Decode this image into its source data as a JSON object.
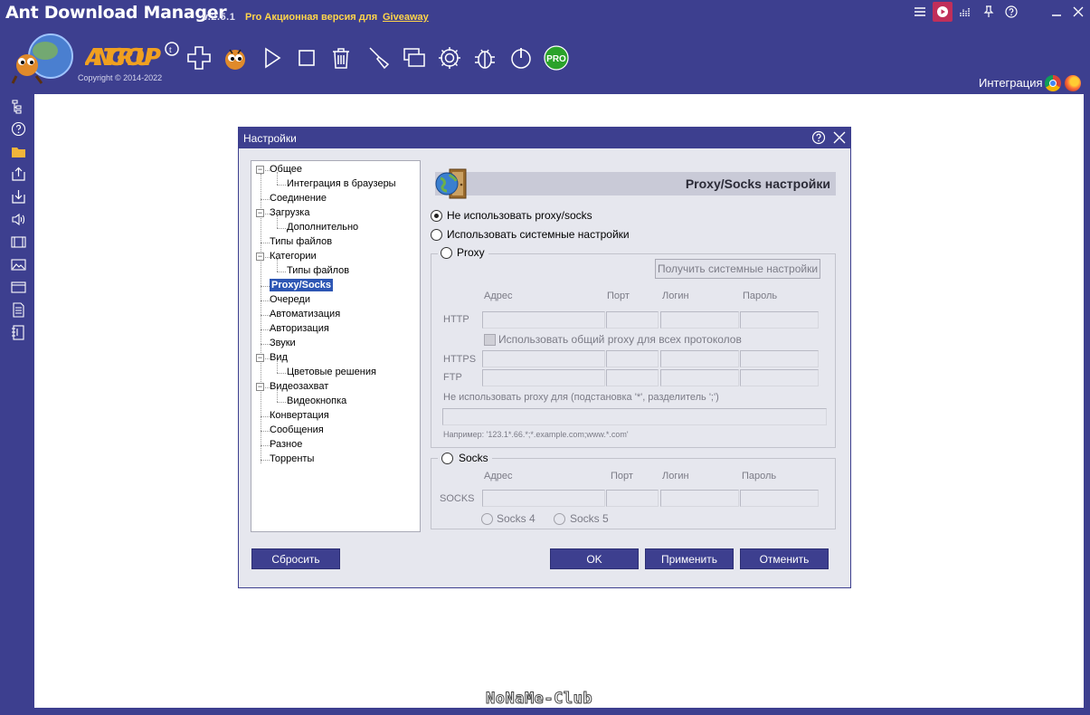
{
  "window": {
    "title": "Ant Download Manager",
    "version": "v.2.5.1",
    "promo": "Pro Акционная версия для",
    "promo_link": "Giveaway"
  },
  "toolbar": {
    "brand_text": "ANT GROUP",
    "copyright": "Copyright © 2014-2022",
    "buttons": [
      "add-icon",
      "ant-icon",
      "play-icon",
      "stop-icon",
      "trash-icon",
      "sweep-icon",
      "windows-icon",
      "gear-icon",
      "bug-icon",
      "power-icon",
      "pro-icon"
    ],
    "pro_label": "PRO",
    "integration_label": "Интеграция"
  },
  "sidebar": {
    "icons": [
      "tree-icon",
      "help-icon",
      "folder-icon",
      "upload-icon",
      "download-icon",
      "audio-icon",
      "video-icon",
      "image-icon",
      "window-icon",
      "document-icon",
      "archive-icon"
    ]
  },
  "dialog": {
    "title": "Настройки",
    "tree": [
      {
        "label": "Общее",
        "level": 0,
        "expandable": true
      },
      {
        "label": "Интеграция в браузеры",
        "level": 1
      },
      {
        "label": "Соединение",
        "level": 0
      },
      {
        "label": "Загрузка",
        "level": 0,
        "expandable": true
      },
      {
        "label": "Дополнительно",
        "level": 1
      },
      {
        "label": "Типы файлов",
        "level": 0
      },
      {
        "label": "Категории",
        "level": 0,
        "expandable": true
      },
      {
        "label": "Типы файлов",
        "level": 1
      },
      {
        "label": "Proxy/Socks",
        "level": 0,
        "selected": true
      },
      {
        "label": "Очереди",
        "level": 0
      },
      {
        "label": "Автоматизация",
        "level": 0
      },
      {
        "label": "Авторизация",
        "level": 0
      },
      {
        "label": "Звуки",
        "level": 0
      },
      {
        "label": "Вид",
        "level": 0,
        "expandable": true
      },
      {
        "label": "Цветовые решения",
        "level": 1
      },
      {
        "label": "Видеозахват",
        "level": 0,
        "expandable": true
      },
      {
        "label": "Видеокнопка",
        "level": 1
      },
      {
        "label": "Конвертация",
        "level": 0
      },
      {
        "label": "Сообщения",
        "level": 0
      },
      {
        "label": "Разное",
        "level": 0
      },
      {
        "label": "Торренты",
        "level": 0
      }
    ],
    "panel_title": "Proxy/Socks настройки",
    "opt_no_proxy": "Не использовать proxy/socks",
    "opt_system": "Использовать системные настройки",
    "opt_proxy": "Proxy",
    "get_system_btn": "Получить системные настройки",
    "col_address": "Адрес",
    "col_port": "Порт",
    "col_login": "Логин",
    "col_password": "Пароль",
    "row_http": "HTTP",
    "use_common": "Использовать общий proxy для всех протоколов",
    "row_https": "HTTPS",
    "row_ftp": "FTP",
    "bypass_label": "Не использовать proxy для (подстановка '*', разделитель ';')",
    "bypass_value": "",
    "bypass_example": "Например: '123.1*.66.*;*.example.com;www.*.com'",
    "opt_socks": "Socks",
    "row_socks": "SOCKS",
    "socks4": "Socks 4",
    "socks5": "Socks 5",
    "btn_reset": "Сбросить",
    "btn_ok": "OK",
    "btn_apply": "Применить",
    "btn_cancel": "Отменить"
  },
  "watermark": "NoNaMe-Club",
  "colors": {
    "frame": "#3d3f8f",
    "dialog_bg": "#e6e7ee",
    "selection": "#2d56b4",
    "promo": "#ffd54a"
  }
}
